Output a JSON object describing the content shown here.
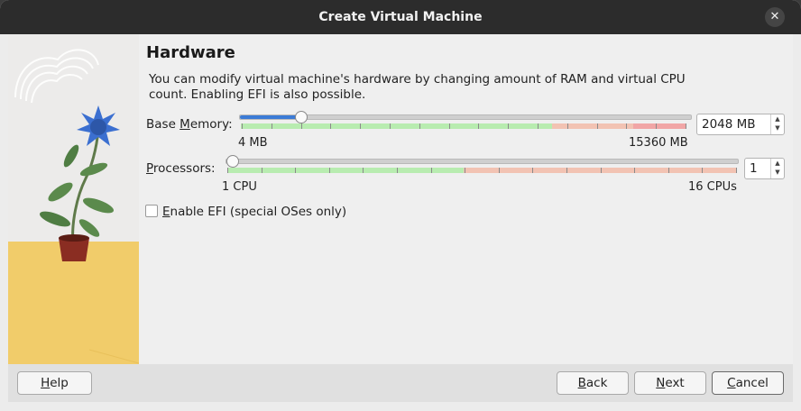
{
  "window": {
    "title": "Create Virtual Machine"
  },
  "page": {
    "heading": "Hardware",
    "description": "You can modify virtual machine's hardware by changing amount of RAM and virtual CPU count. Enabling EFI is also possible."
  },
  "memory": {
    "label_prefix": "Base ",
    "label_accel": "M",
    "label_suffix": "emory:",
    "value": "2048 MB",
    "min_label": "4 MB",
    "max_label": "15360 MB",
    "level": 0.133
  },
  "processors": {
    "label_accel": "P",
    "label_suffix": "rocessors:",
    "value": "1",
    "min_label": "1 CPU",
    "max_label": "16 CPUs",
    "level": 0.0
  },
  "efi": {
    "label_accel": "E",
    "label_suffix": "nable EFI (special OSes only)",
    "checked": false
  },
  "buttons": {
    "help_accel": "H",
    "help_rest": "elp",
    "back_accel": "B",
    "back_rest": "ack",
    "next_accel": "N",
    "next_rest": "ext",
    "cancel_accel": "C",
    "cancel_rest": "ancel"
  },
  "colors": {
    "slider_fill": "#3b7bd6",
    "band_ok": "#b8ecb0",
    "band_warn": "#f2c3b3",
    "band_bad": "#f1a6a6",
    "illustration_ground": "#f1cc6a"
  },
  "icons": {
    "close": "close-icon",
    "spin_up": "arrow-up-icon",
    "spin_down": "arrow-down-icon"
  }
}
